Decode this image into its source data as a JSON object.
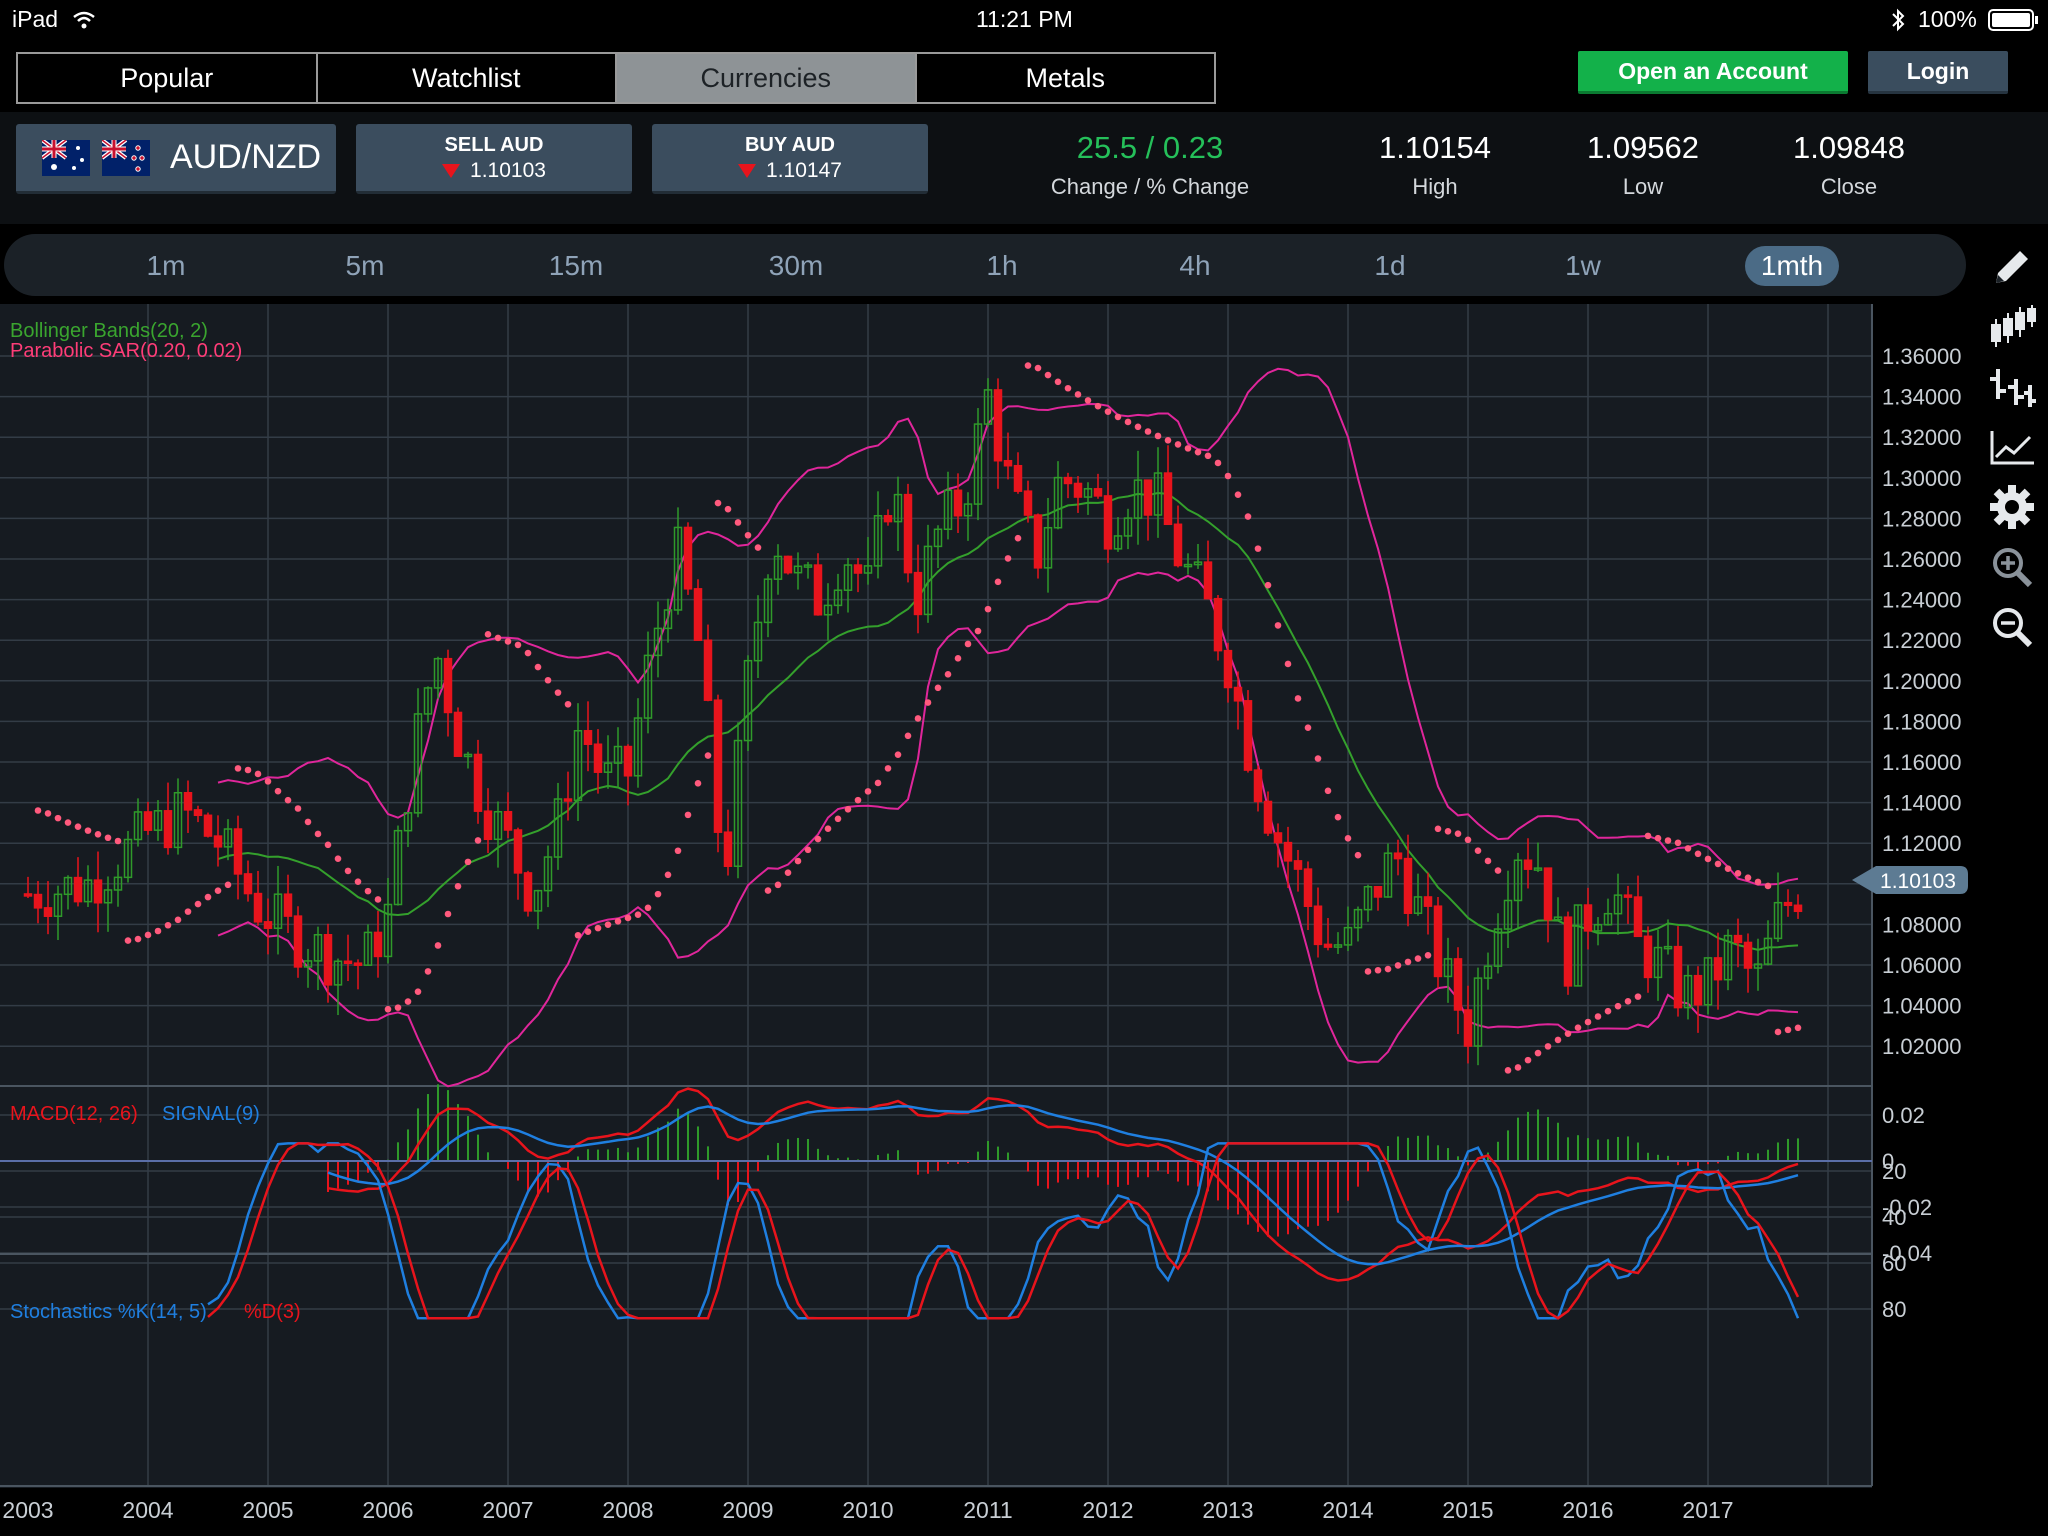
{
  "status_bar": {
    "device": "iPad",
    "time": "11:21 PM",
    "battery": "100%"
  },
  "nav_tabs": [
    {
      "label": "Popular",
      "active": false
    },
    {
      "label": "Watchlist",
      "active": false
    },
    {
      "label": "Currencies",
      "active": true
    },
    {
      "label": "Metals",
      "active": false
    }
  ],
  "header": {
    "open_account": "Open an Account",
    "login": "Login"
  },
  "quote": {
    "pair": "AUD/NZD",
    "sell_label": "SELL AUD",
    "sell_price": "1.10103",
    "buy_label": "BUY AUD",
    "buy_price": "1.10147",
    "change_value": "25.5 / 0.23",
    "change_label": "Change / % Change",
    "high_value": "1.10154",
    "high_label": "High",
    "low_value": "1.09562",
    "low_label": "Low",
    "close_value": "1.09848",
    "close_label": "Close"
  },
  "timeframes": [
    "1m",
    "5m",
    "15m",
    "30m",
    "1h",
    "4h",
    "1d",
    "1w",
    "1mth"
  ],
  "active_timeframe": "1mth",
  "tools": [
    "pencil-icon",
    "candlestick-icon",
    "ohlc-bars-icon",
    "line-chart-icon",
    "gear-icon",
    "zoom-in-icon",
    "zoom-out-icon"
  ],
  "colors": {
    "up": "#2f9a2a",
    "down": "#e8141c",
    "bollinger": "#e0269b",
    "bb_mid": "#34a02c",
    "sar": "#ff5a7d",
    "macd": "#e8141c",
    "signal": "#1f7fe0",
    "accent": "#4b6b86"
  },
  "chart_data": [
    {
      "type": "candlestick",
      "title": "Bollinger Bands(20, 2)",
      "subtitle": "Parabolic SAR(0.20, 0.02)",
      "x_tick_labels": [
        "2003",
        "2004",
        "2005",
        "2006",
        "2007",
        "2008",
        "2009",
        "2010",
        "2011",
        "2012",
        "2013",
        "2014",
        "2015",
        "2016",
        "2017"
      ],
      "y_tick_labels": [
        "1.36000",
        "1.34000",
        "1.32000",
        "1.30000",
        "1.28000",
        "1.26000",
        "1.24000",
        "1.22000",
        "1.20000",
        "1.18000",
        "1.16000",
        "1.14000",
        "1.12000",
        "1.10000",
        "1.08000",
        "1.06000",
        "1.04000",
        "1.02000"
      ],
      "ylim": [
        1.0,
        1.38
      ],
      "current_price": "1.10103",
      "close_series": [
        [
          2003.0,
          1.095
        ],
        [
          2003.5,
          1.1
        ],
        [
          2004.0,
          1.125
        ],
        [
          2004.3,
          1.135
        ],
        [
          2004.6,
          1.12
        ],
        [
          2004.9,
          1.09
        ],
        [
          2005.2,
          1.075
        ],
        [
          2005.5,
          1.065
        ],
        [
          2005.8,
          1.06
        ],
        [
          2006.0,
          1.085
        ],
        [
          2006.2,
          1.16
        ],
        [
          2006.4,
          1.215
        ],
        [
          2006.6,
          1.17
        ],
        [
          2006.8,
          1.14
        ],
        [
          2007.0,
          1.12
        ],
        [
          2007.2,
          1.095
        ],
        [
          2007.4,
          1.125
        ],
        [
          2007.6,
          1.18
        ],
        [
          2007.8,
          1.15
        ],
        [
          2008.0,
          1.155
        ],
        [
          2008.2,
          1.215
        ],
        [
          2008.4,
          1.265
        ],
        [
          2008.6,
          1.215
        ],
        [
          2008.8,
          1.1
        ],
        [
          2009.0,
          1.2
        ],
        [
          2009.2,
          1.275
        ],
        [
          2009.4,
          1.25
        ],
        [
          2009.6,
          1.24
        ],
        [
          2009.8,
          1.265
        ],
        [
          2010.0,
          1.245
        ],
        [
          2010.2,
          1.3
        ],
        [
          2010.4,
          1.24
        ],
        [
          2010.6,
          1.275
        ],
        [
          2010.8,
          1.29
        ],
        [
          2011.0,
          1.34
        ],
        [
          2011.2,
          1.29
        ],
        [
          2011.4,
          1.26
        ],
        [
          2011.6,
          1.3
        ],
        [
          2011.8,
          1.295
        ],
        [
          2012.0,
          1.28
        ],
        [
          2012.2,
          1.295
        ],
        [
          2012.4,
          1.29
        ],
        [
          2012.6,
          1.26
        ],
        [
          2012.8,
          1.24
        ],
        [
          2013.0,
          1.21
        ],
        [
          2013.2,
          1.16
        ],
        [
          2013.4,
          1.125
        ],
        [
          2013.6,
          1.1
        ],
        [
          2013.8,
          1.07
        ],
        [
          2014.0,
          1.07
        ],
        [
          2014.2,
          1.095
        ],
        [
          2014.4,
          1.115
        ],
        [
          2014.6,
          1.085
        ],
        [
          2014.8,
          1.055
        ],
        [
          2015.0,
          1.03
        ],
        [
          2015.2,
          1.08
        ],
        [
          2015.4,
          1.12
        ],
        [
          2015.6,
          1.11
        ],
        [
          2015.8,
          1.06
        ],
        [
          2016.0,
          1.085
        ],
        [
          2016.2,
          1.1
        ],
        [
          2016.4,
          1.07
        ],
        [
          2016.6,
          1.06
        ],
        [
          2016.8,
          1.045
        ],
        [
          2017.0,
          1.05
        ],
        [
          2017.2,
          1.07
        ],
        [
          2017.4,
          1.05
        ],
        [
          2017.6,
          1.085
        ],
        [
          2017.8,
          1.101
        ]
      ]
    },
    {
      "type": "line",
      "title": "MACD(12, 26)",
      "subtitle": "SIGNAL(9)",
      "y_tick_labels": [
        "0.02",
        "0",
        "-0.02",
        "-0.04"
      ],
      "ylim": [
        -0.05,
        0.03
      ]
    },
    {
      "type": "line",
      "title": "Stochastics %K(14, 5)",
      "subtitle": "%D(3)",
      "y_tick_labels": [
        "80",
        "60",
        "40",
        "20"
      ],
      "ylim": [
        5,
        85
      ]
    }
  ]
}
